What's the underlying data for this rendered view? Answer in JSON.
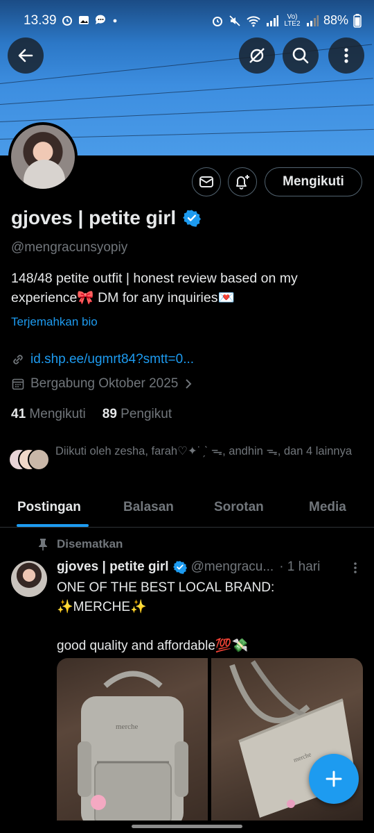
{
  "status_bar": {
    "time": "13.39",
    "network_label": "Vo) LTE2",
    "battery": "88%"
  },
  "profile": {
    "name": "gjoves | petite girl",
    "handle": "@mengracunsyopiy",
    "bio": "148/48 petite outfit | honest review based on my experience🎀 DM for any inquiries💌",
    "translate_label": "Terjemahkan bio",
    "link": "id.shp.ee/ugmrt84?smtt=0...",
    "joined": "Bergabung Oktober 2025",
    "following_count": "41",
    "following_label": "Mengikuti",
    "followers_count": "89",
    "followers_label": "Pengikut",
    "followed_by": "Diikuti oleh zesha, farah♡✦˙ ̗ˋ ᯓ, andhin ᯓ, dan 4 lainnya",
    "follow_button": "Mengikuti"
  },
  "tabs": [
    {
      "label": "Postingan"
    },
    {
      "label": "Balasan"
    },
    {
      "label": "Sorotan"
    },
    {
      "label": "Media"
    }
  ],
  "tweet": {
    "pinned_label": "Disematkan",
    "author_name": "gjoves | petite girl",
    "author_handle": "@mengracu...",
    "time": "· 1 hari",
    "text": "ONE OF THE BEST LOCAL BRAND:\n✨MERCHE✨\n\ngood quality and affordable💯💸",
    "media_1_brand": "merche",
    "media_2_brand": "merche"
  },
  "colors": {
    "accent": "#1d9bf0",
    "muted": "#71767b",
    "text": "#e7e9ea",
    "background": "#000000"
  },
  "icons": {
    "back": "back-arrow-icon",
    "grok": "grok-icon",
    "search": "search-icon",
    "more": "more-vertical-icon",
    "message": "message-icon",
    "notify": "bell-plus-icon",
    "verified": "verified-badge-icon",
    "link": "link-icon",
    "calendar": "calendar-icon",
    "pin": "pin-icon",
    "compose": "plus-icon"
  }
}
